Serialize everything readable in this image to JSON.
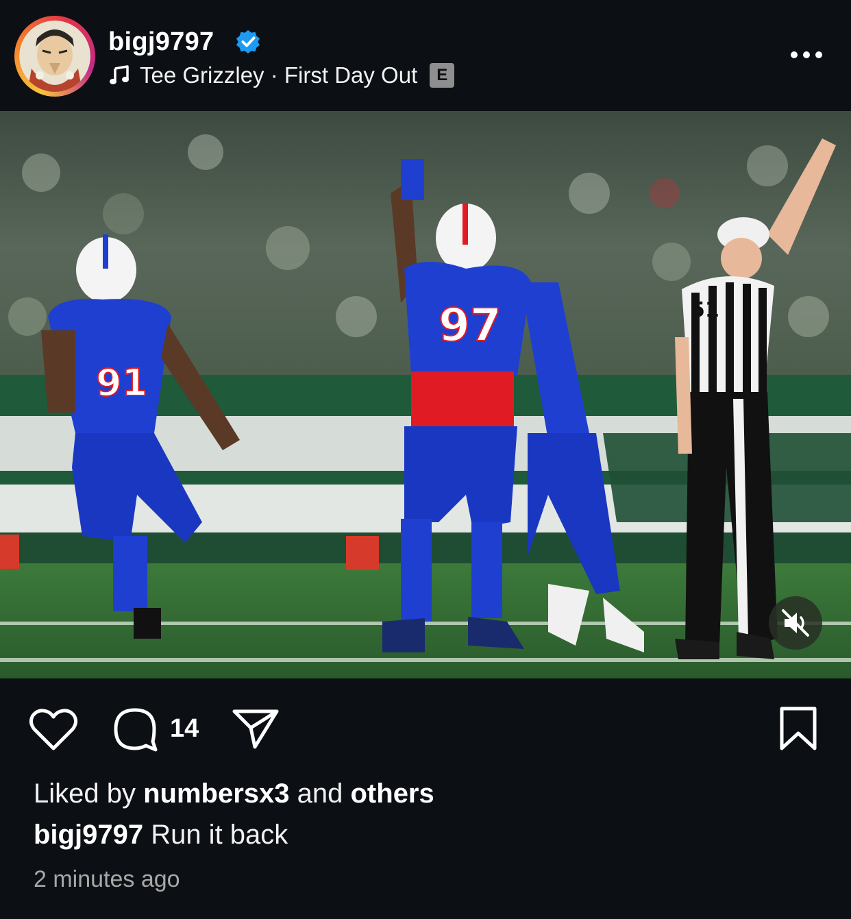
{
  "header": {
    "username": "bigj9797",
    "verified_icon": "verified-badge-icon",
    "music_icon": "music-note-icon",
    "music_text": "Tee Grizzley · First Day Out",
    "explicit_label": "E",
    "more_icon": "more-options-icon"
  },
  "post": {
    "image_icon": "sports-photo",
    "mute_icon": "muted-speaker-icon",
    "photo_jersey_numbers": [
      "91",
      "97",
      "51"
    ]
  },
  "actions": {
    "like_icon": "heart-icon",
    "comment_icon": "comment-icon",
    "comment_count": "14",
    "share_icon": "send-icon",
    "save_icon": "bookmark-icon"
  },
  "likes": {
    "prefix": "Liked by ",
    "user": "numbersx3",
    "middle": " and ",
    "others": "others"
  },
  "caption": {
    "user": "bigj9797",
    "text": " Run it back"
  },
  "timestamp": "2 minutes ago",
  "colors": {
    "background": "#0c0f14",
    "verified_blue": "#1d9bf0",
    "bills_blue": "#1f3fd1",
    "bills_red": "#e01b24",
    "turf_green": "#2f6a33"
  }
}
